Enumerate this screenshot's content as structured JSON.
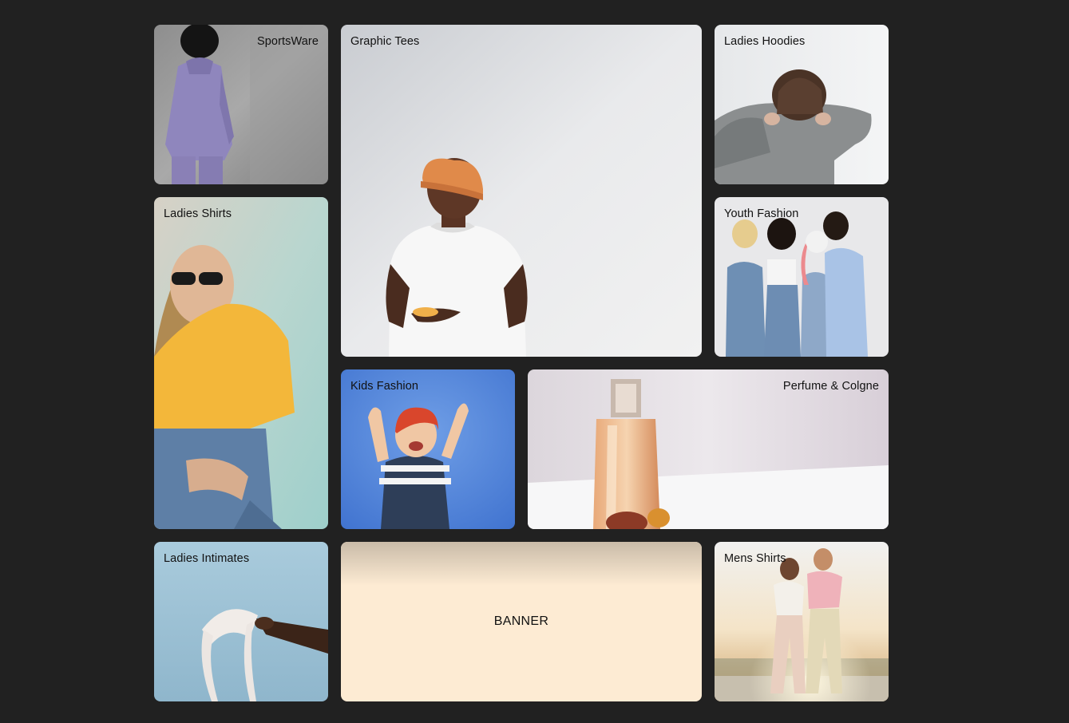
{
  "tiles": {
    "sports": {
      "label": "SportsWare"
    },
    "graphic": {
      "label": "Graphic Tees"
    },
    "hoodies": {
      "label": "Ladies Hoodies"
    },
    "ladies_shirts": {
      "label": "Ladies Shirts"
    },
    "youth": {
      "label": "Youth Fashion"
    },
    "kids": {
      "label": "Kids Fashion"
    },
    "perfume": {
      "label": "Perfume & Colgne"
    },
    "intimates": {
      "label": "Ladies Intimates"
    },
    "banner": {
      "label": "BANNER"
    },
    "mens": {
      "label": "Mens Shirts"
    }
  },
  "colors": {
    "page_background": "#212121",
    "banner_background": "#fdebd3"
  }
}
